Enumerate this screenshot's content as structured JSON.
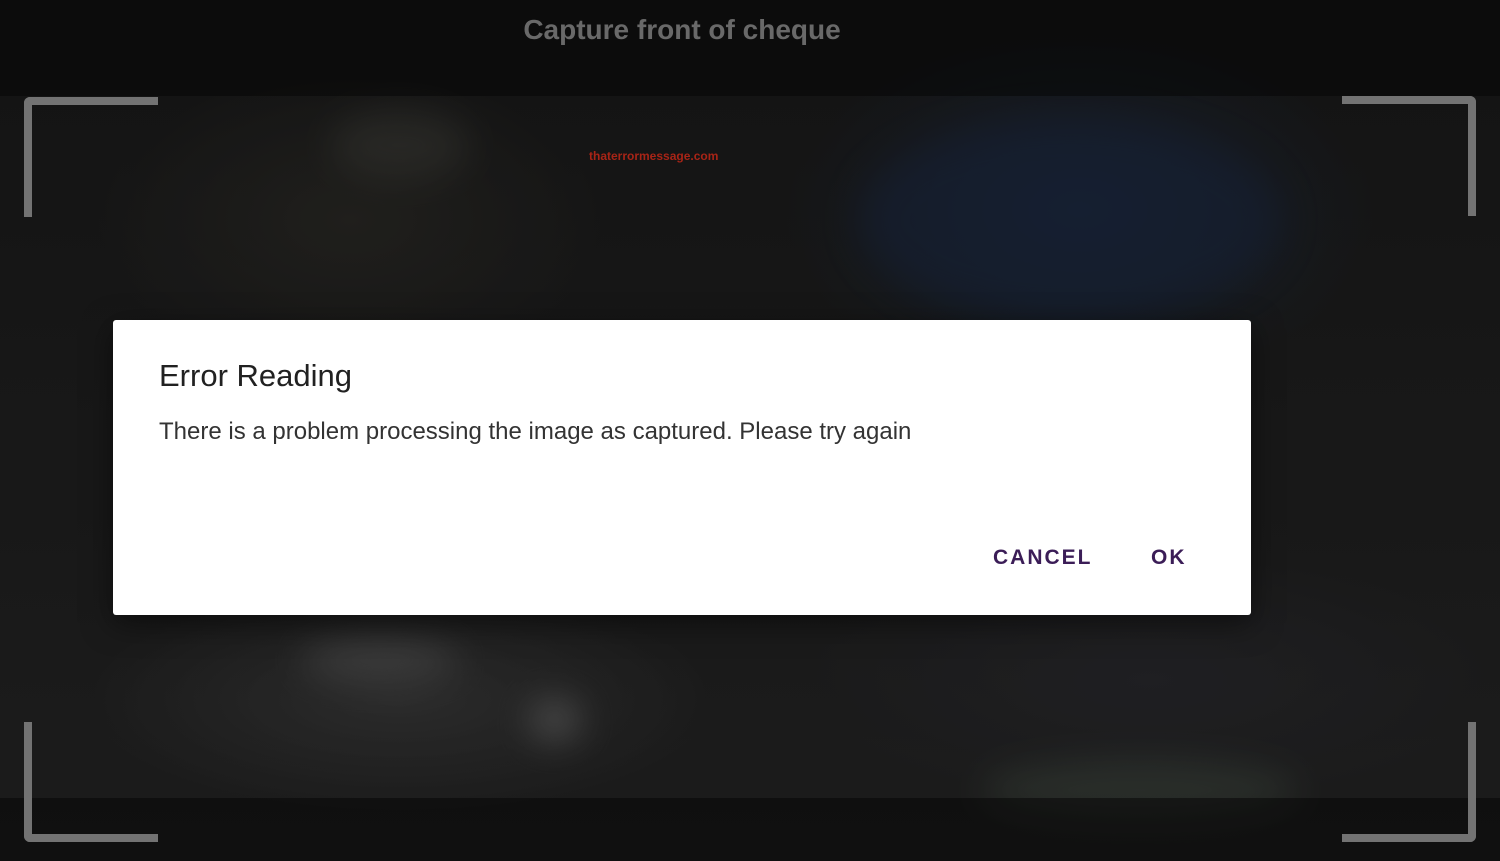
{
  "screen": {
    "title": "Capture front of cheque",
    "watermark": "thaterrormessage.com"
  },
  "dialog": {
    "title": "Error Reading",
    "message": "There is a problem processing the image as captured. Please try again",
    "cancel_label": "CANCEL",
    "ok_label": "OK"
  },
  "colors": {
    "accent": "#3b1d57",
    "watermark": "#e0301e",
    "dialog_bg": "#ffffff"
  }
}
